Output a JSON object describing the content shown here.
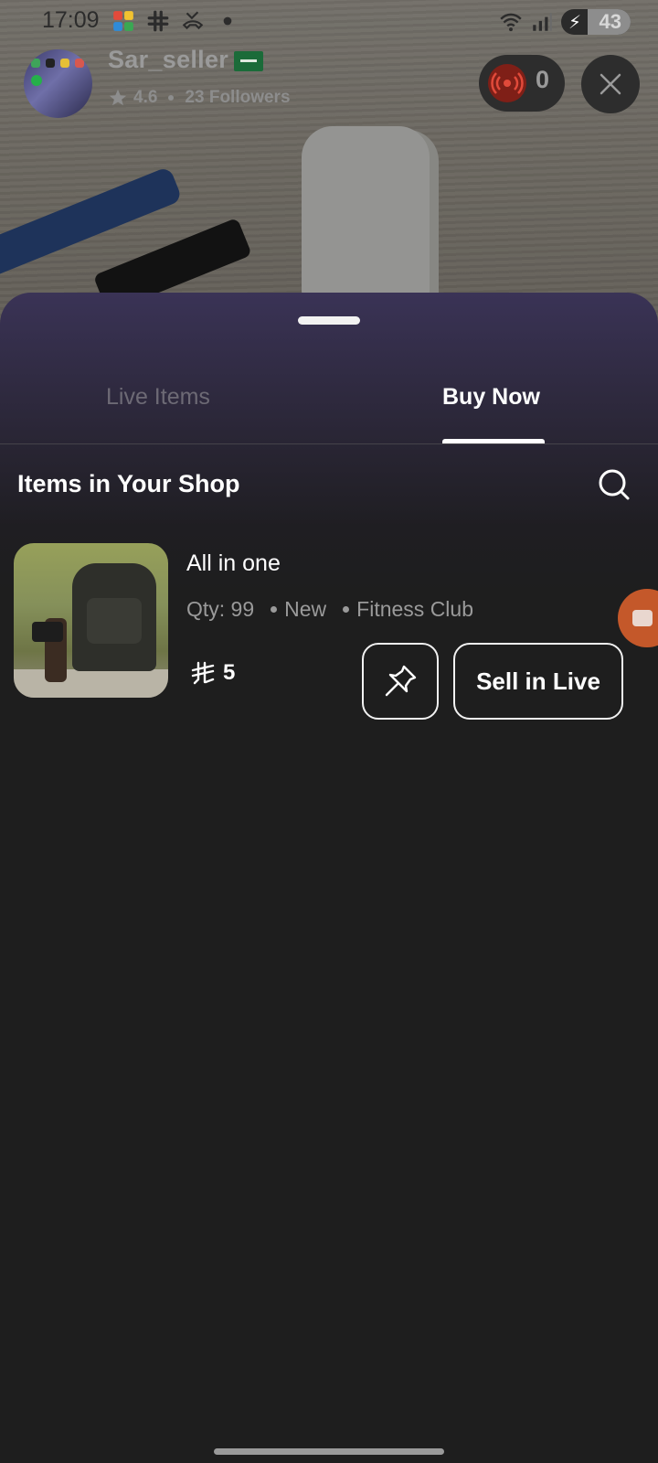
{
  "status_bar": {
    "time": "17:09",
    "battery": "43",
    "left_icons": [
      "app-grid-icon",
      "slack-icon",
      "missed-call-icon",
      "dot-icon"
    ],
    "right_icons": [
      "wifi-icon",
      "signal-icon",
      "battery-icon"
    ]
  },
  "seller": {
    "name": "Sar_seller",
    "rating": "4.6",
    "followers": "23 Followers",
    "flag_icon": "saudi-flag-icon"
  },
  "live": {
    "viewer_count": "0"
  },
  "tabs": [
    {
      "label": "Live Items",
      "active": false
    },
    {
      "label": "Buy Now",
      "active": true
    }
  ],
  "section": {
    "title": "Items in Your Shop"
  },
  "items": [
    {
      "name": "All in one",
      "qty": "Qty: 99",
      "condition": "New",
      "category": "Fitness Club",
      "price": "5",
      "currency_icon": "saudi-riyal-icon",
      "sell_label": "Sell in Live"
    }
  ],
  "colors": {
    "sheet_bg": "#1e1e1e",
    "sheet_top": "#3a3356",
    "live_red": "#c62a1c",
    "float_orange": "#c4582a"
  }
}
